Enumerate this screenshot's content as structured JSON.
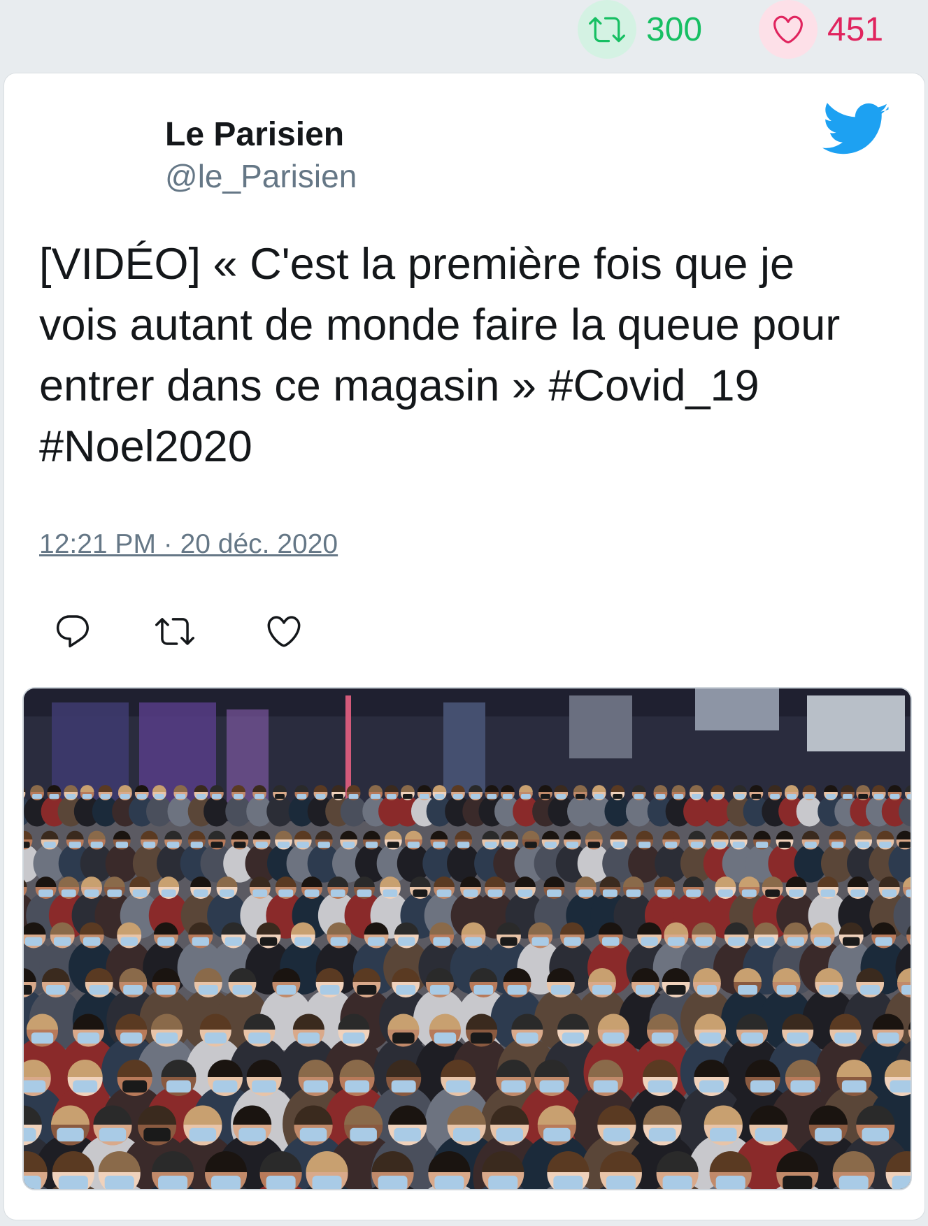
{
  "stats": {
    "retweets": "300",
    "likes": "451",
    "retweet_icon": "retweet-icon",
    "like_icon": "heart-icon",
    "retweet_color": "#17bf63",
    "like_color": "#e0245e"
  },
  "tweet": {
    "author_name": "Le Parisien",
    "author_handle": "@le_Parisien",
    "text": "[VIDÉO] « C'est la première fois que je\nvois autant de monde faire la queue pour\nentrer dans ce magasin » #Covid_19\n#Noel2020",
    "timestamp": "12:21 PM · 20 déc. 2020",
    "brand_icon": "twitter-bird-icon",
    "brand_color": "#1da1f2"
  },
  "actions": [
    {
      "icon": "reply-icon"
    },
    {
      "icon": "retweet-icon"
    },
    {
      "icon": "like-icon"
    }
  ],
  "media": {
    "type": "photo",
    "subject_icon": "crowd-photo"
  }
}
